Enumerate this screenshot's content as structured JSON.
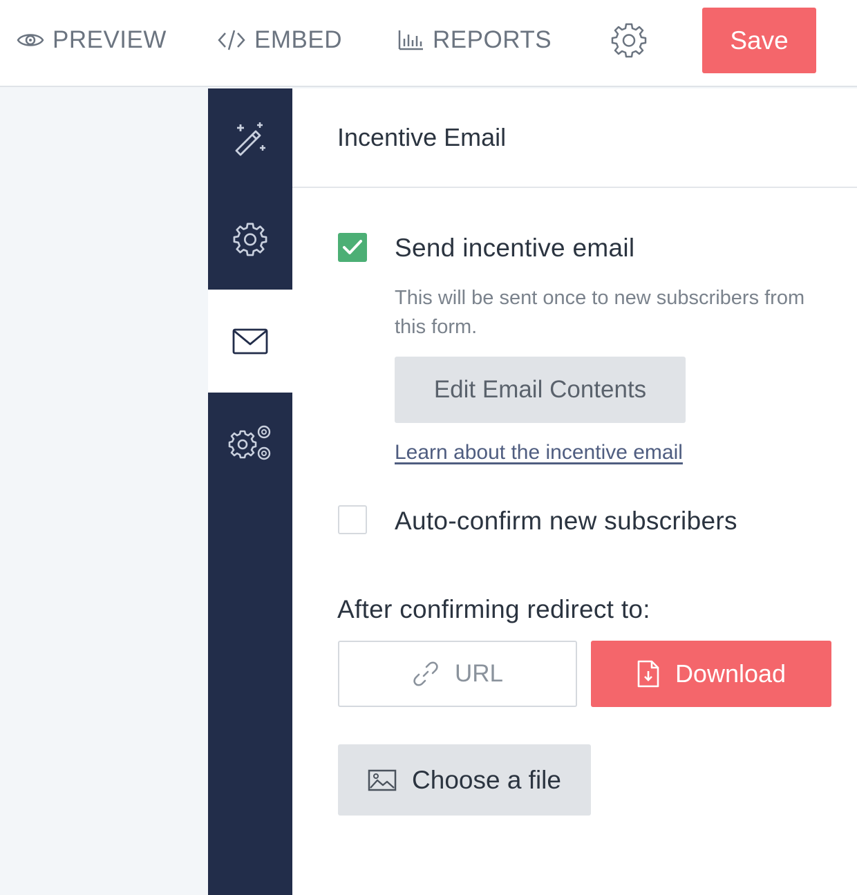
{
  "topbar": {
    "preview_label": "PREVIEW",
    "embed_label": "EMBED",
    "reports_label": "REPORTS",
    "save_label": "Save"
  },
  "rail": {
    "items": [
      {
        "icon": "magic-wand-icon",
        "active": false
      },
      {
        "icon": "gear-icon",
        "active": false
      },
      {
        "icon": "envelope-icon",
        "active": true
      },
      {
        "icon": "advanced-settings-icon",
        "active": false
      }
    ]
  },
  "panel": {
    "title": "Incentive Email",
    "send_incentive": {
      "label": "Send incentive email",
      "checked": true,
      "helper": "This will be sent once to new subscribers from this form."
    },
    "edit_button_label": "Edit Email Contents",
    "learn_link_label": "Learn about the incentive email",
    "auto_confirm": {
      "label": "Auto-confirm new subscribers",
      "checked": false
    },
    "redirect_label": "After confirming redirect to:",
    "redirect_options": {
      "url_label": "URL",
      "download_label": "Download",
      "selected": "Download"
    },
    "choose_file_label": "Choose a file"
  },
  "colors": {
    "accent": "#f4666b",
    "rail": "#222d4a",
    "checkbox_checked": "#4caf75"
  }
}
